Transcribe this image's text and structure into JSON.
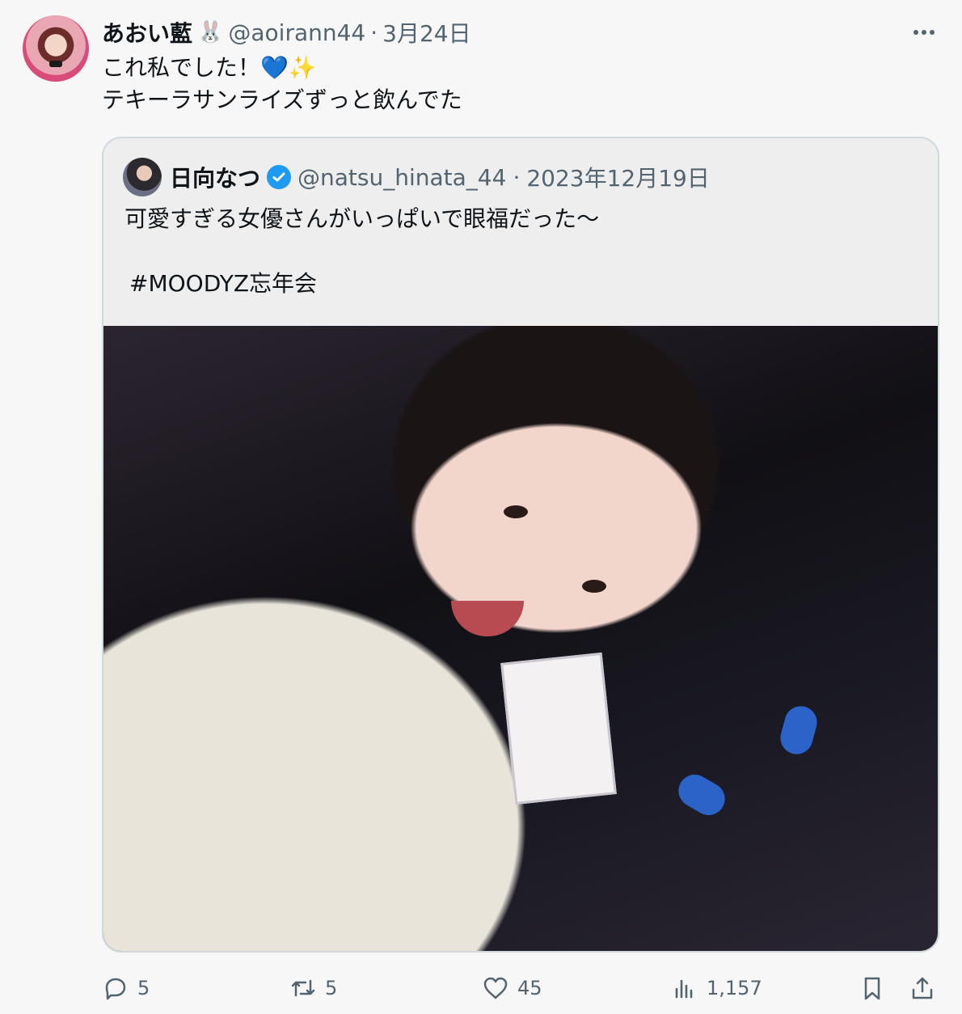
{
  "tweet": {
    "display_name": "あおい藍",
    "name_emoji": "🐰",
    "handle": "@aoirann44",
    "separator": "·",
    "date": "3月24日",
    "text_line1": "これ私でした！",
    "text_emoji1": "💙",
    "text_emoji2": "✨",
    "text_line2": "テキーラサンライズずっと飲んでた"
  },
  "quote": {
    "display_name": "日向なつ",
    "handle": "@natsu_hinata_44",
    "separator": "·",
    "date": "2023年12月19日",
    "text_line1": "可愛すぎる女優さんがいっぱいで眼福だった〜",
    "hashtag": "#MOODYZ忘年会"
  },
  "actions": {
    "replies": "5",
    "retweets": "5",
    "likes": "45",
    "views": "1,157"
  },
  "icons": {
    "more": "more-icon",
    "reply": "reply-icon",
    "retweet": "retweet-icon",
    "like": "heart-icon",
    "views": "views-icon",
    "bookmark": "bookmark-icon",
    "share": "share-icon",
    "verified": "verified-icon"
  },
  "colors": {
    "secondary_text": "#536471",
    "verified_blue": "#1d9bf0",
    "border": "#cfd9de"
  }
}
